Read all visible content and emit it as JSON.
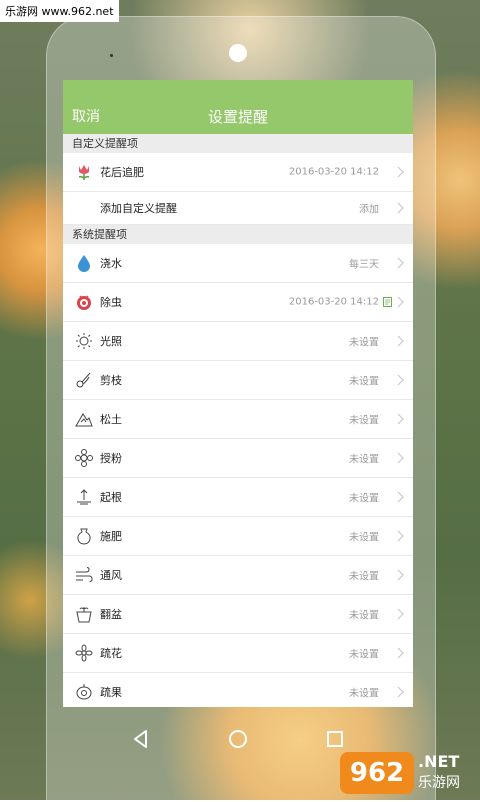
{
  "watermark": "乐游网 www.962.net",
  "header": {
    "cancel_label": "取消",
    "title": "设置提醒"
  },
  "custom_section": {
    "heading": "自定义提醒项",
    "items": [
      {
        "label": "花后追肥",
        "value": "2016-03-20 14:12",
        "icon": "tulip-icon"
      },
      {
        "label": "添加自定义提醒",
        "value": "添加"
      }
    ]
  },
  "system_section": {
    "heading": "系统提醒项",
    "items": [
      {
        "label": "浇水",
        "value": "每三天",
        "icon": "water-drop-icon"
      },
      {
        "label": "除虫",
        "value": "2016-03-20 14:12",
        "icon": "bug-icon",
        "note_icon": "note-icon"
      },
      {
        "label": "光照",
        "value": "未设置",
        "icon": "sun-icon"
      },
      {
        "label": "剪枝",
        "value": "未设置",
        "icon": "scissors-icon"
      },
      {
        "label": "松土",
        "value": "未设置",
        "icon": "soil-icon"
      },
      {
        "label": "授粉",
        "value": "未设置",
        "icon": "pollinate-icon"
      },
      {
        "label": "起根",
        "value": "未设置",
        "icon": "root-icon"
      },
      {
        "label": "施肥",
        "value": "未设置",
        "icon": "fertilizer-icon"
      },
      {
        "label": "通风",
        "value": "未设置",
        "icon": "wind-icon"
      },
      {
        "label": "翻盆",
        "value": "未设置",
        "icon": "pot-icon"
      },
      {
        "label": "疏花",
        "value": "未设置",
        "icon": "flower-thin-icon"
      },
      {
        "label": "疏果",
        "value": "未设置",
        "icon": "fruit-thin-icon"
      }
    ]
  },
  "logo": {
    "badge": "962",
    "net": ".NET",
    "sub": "乐游网"
  },
  "colors": {
    "accent": "#94c86a",
    "alert_red": "#d9434b",
    "water_blue": "#3b93d6"
  }
}
